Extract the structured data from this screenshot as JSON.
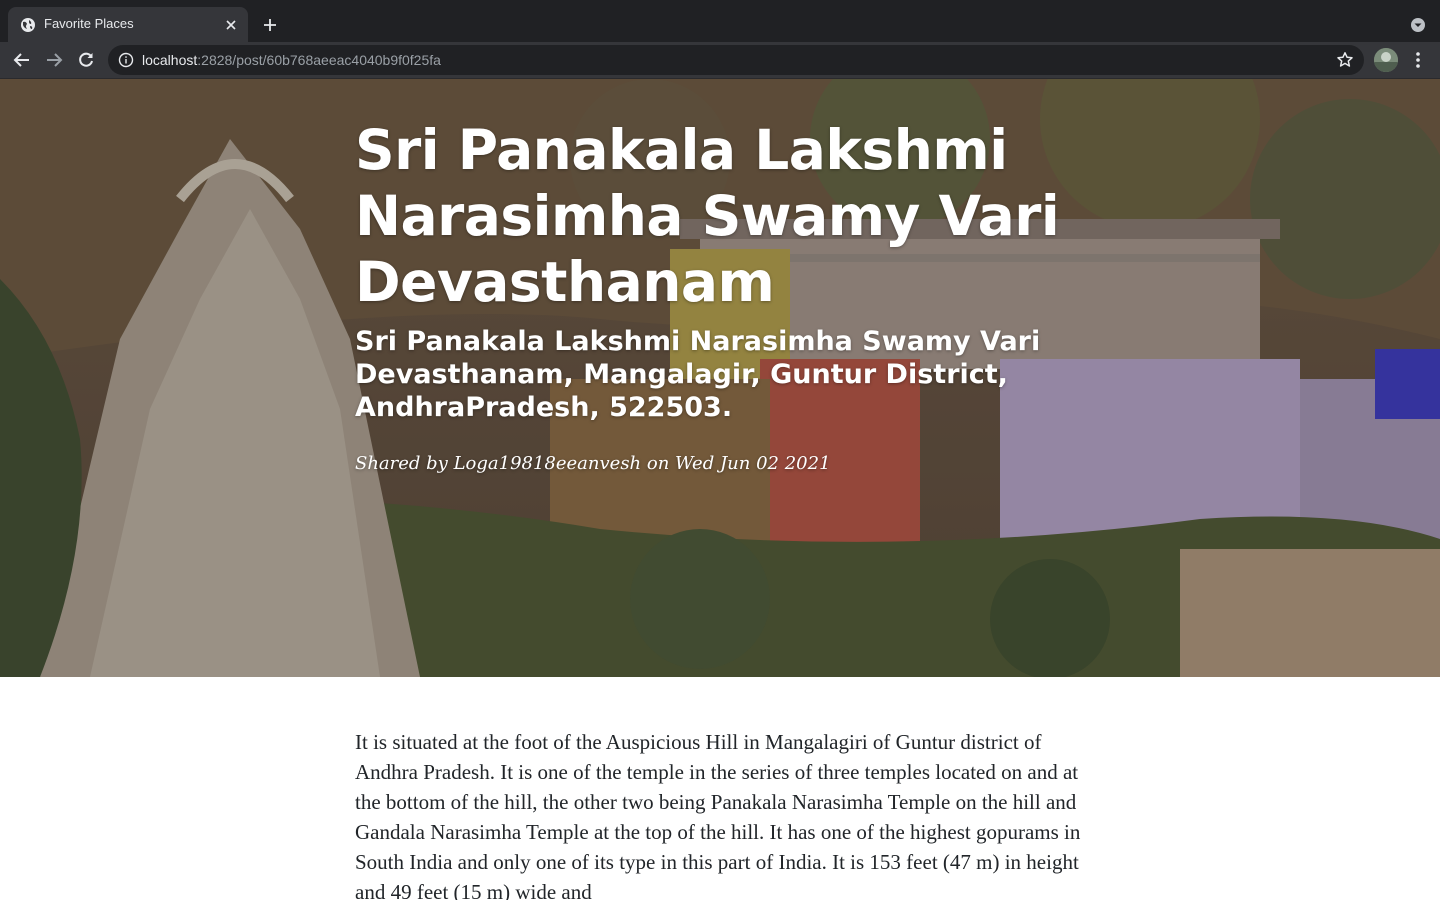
{
  "browser": {
    "tab": {
      "title": "Favorite Places",
      "favicon": "globe-icon"
    },
    "address": {
      "host": "localhost",
      "path": ":2828/post/60b768aeeac4040b9f0f25fa"
    }
  },
  "post": {
    "title": "Sri Panakala Lakshmi Narasimha Swamy Vari Devasthanam",
    "subtitle": "Sri Panakala Lakshmi Narasimha Swamy Vari Devasthanam, Mangalagir, Guntur District, AndhraPradesh, 522503.",
    "meta": "Shared by Loga19818eeanvesh on Wed Jun 02 2021",
    "body": "It is situated at the foot of the Auspicious Hill in Mangalagiri of Guntur district of Andhra Pradesh. It is one of the temple in the series of three temples located on and at the bottom of the hill, the other two being Panakala Narasimha Temple on the hill and Gandala Narasimha Temple at the top of the hill. It has one of the highest gopurams in South India and only one of its type in this part of India. It is 153 feet (47 m) in height and 49 feet (15 m) wide and"
  },
  "colors": {
    "chrome_dark": "#202124",
    "chrome_tab": "#35363a",
    "text_primary": "#212529",
    "hero_text": "#ffffff"
  }
}
